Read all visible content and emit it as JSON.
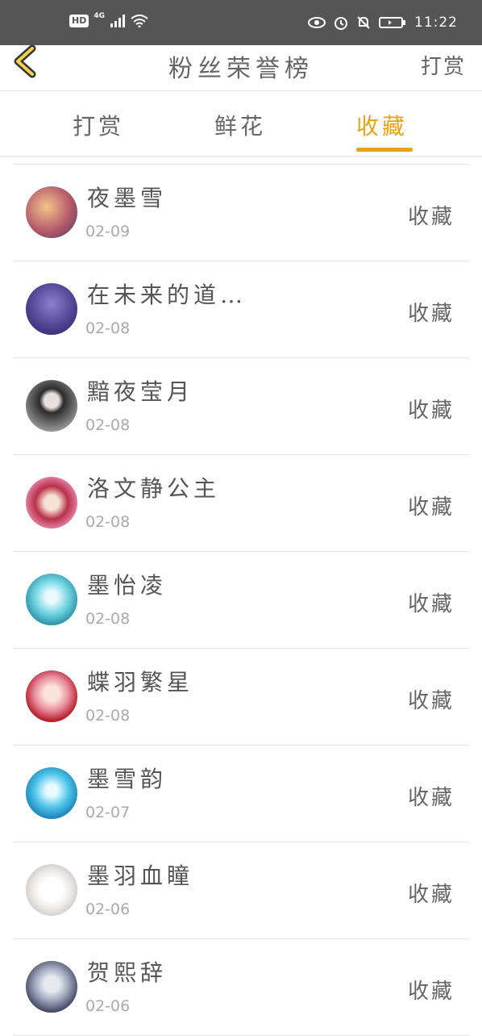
{
  "status_bar": {
    "left_badge": "HD",
    "network": "4G",
    "time": "11:22"
  },
  "navbar": {
    "title": "粉丝荣誉榜",
    "right_action": "打赏"
  },
  "tabs": [
    {
      "label": "打赏",
      "active": false
    },
    {
      "label": "鲜花",
      "active": false
    },
    {
      "label": "收藏",
      "active": true
    }
  ],
  "accent_color": "#e8a21c",
  "fans": [
    {
      "name": "夜墨雪",
      "date": "02-09",
      "action": "收藏"
    },
    {
      "name": "在未来的道…",
      "date": "02-08",
      "action": "收藏"
    },
    {
      "name": "黯夜莹月",
      "date": "02-08",
      "action": "收藏"
    },
    {
      "name": "洛文静公主",
      "date": "02-08",
      "action": "收藏"
    },
    {
      "name": "墨怡凌",
      "date": "02-08",
      "action": "收藏"
    },
    {
      "name": "蝶羽繁星",
      "date": "02-08",
      "action": "收藏"
    },
    {
      "name": "墨雪韵",
      "date": "02-07",
      "action": "收藏"
    },
    {
      "name": "墨羽血瞳",
      "date": "02-06",
      "action": "收藏"
    },
    {
      "name": "贺熙辞",
      "date": "02-06",
      "action": "收藏"
    }
  ]
}
